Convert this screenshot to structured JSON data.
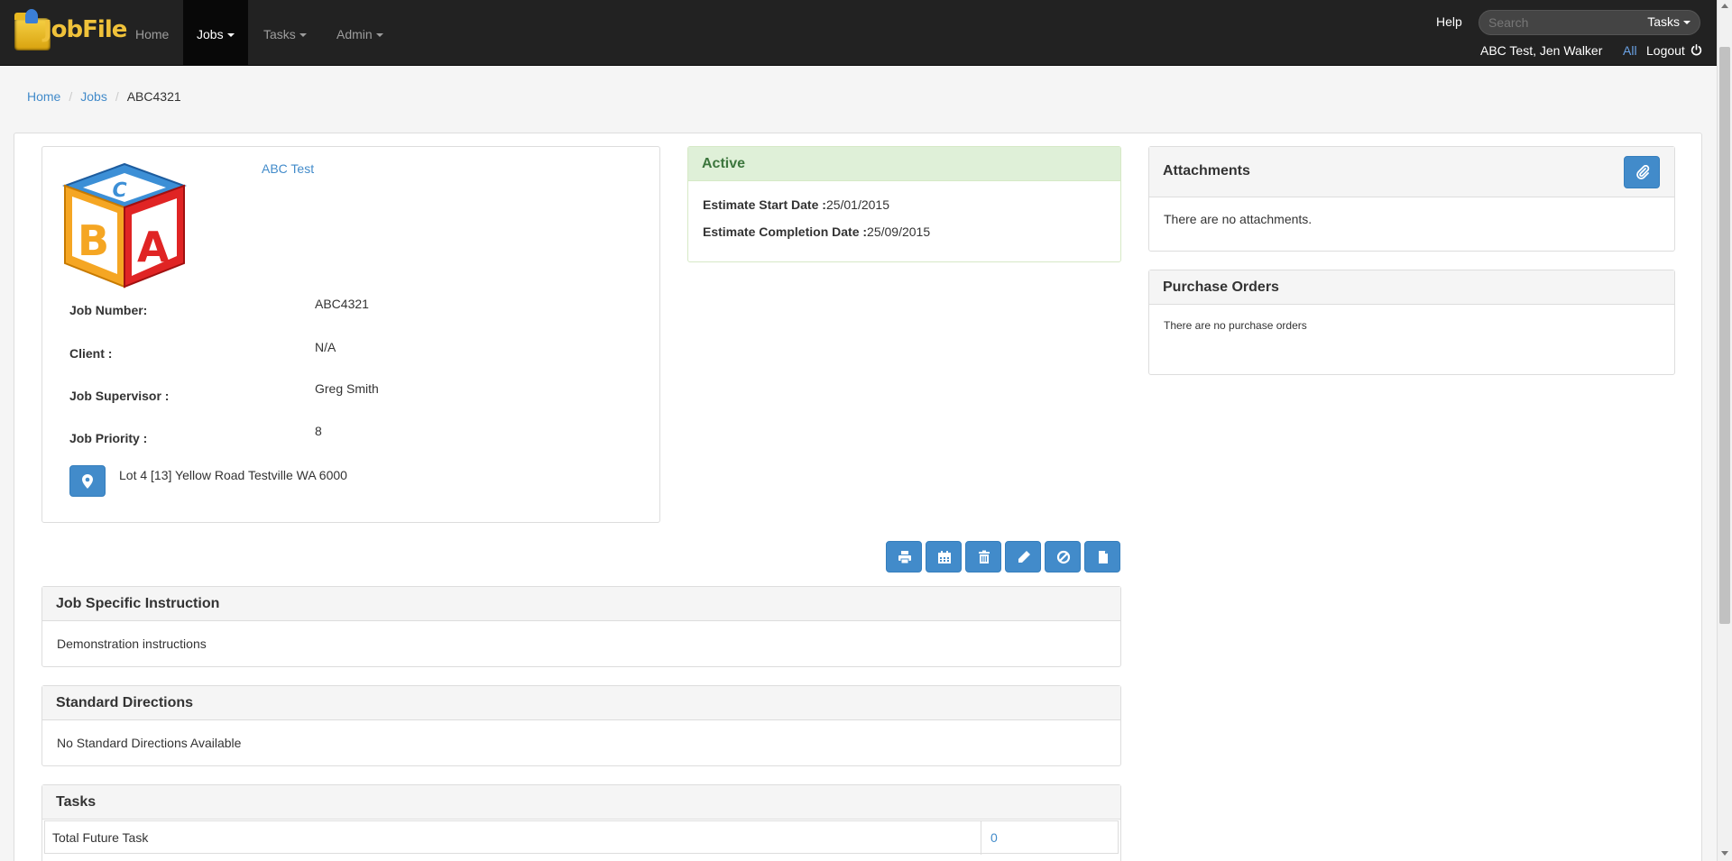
{
  "navbar": {
    "brand": "JobFile",
    "items": [
      {
        "label": "Home",
        "active": false,
        "dropdown": false
      },
      {
        "label": "Jobs",
        "active": true,
        "dropdown": true
      },
      {
        "label": "Tasks",
        "active": false,
        "dropdown": true
      },
      {
        "label": "Admin",
        "active": false,
        "dropdown": true
      }
    ],
    "help": "Help",
    "search": {
      "placeholder": "Search",
      "scope": "Tasks"
    },
    "user": "ABC Test, Jen Walker",
    "all": "All",
    "logout": "Logout"
  },
  "breadcrumb": [
    "Home",
    "Jobs",
    "ABC4321"
  ],
  "job": {
    "client_link": "ABC Test",
    "fields": [
      {
        "label": "Job Number:",
        "value": "ABC4321"
      },
      {
        "label": "Client :",
        "value": "N/A"
      },
      {
        "label": "Job Supervisor :",
        "value": "Greg Smith"
      },
      {
        "label": "Job Priority :",
        "value": "8"
      }
    ],
    "address": "Lot 4 [13] Yellow Road Testville WA 6000"
  },
  "status": {
    "title": "Active",
    "start_label": "Estimate Start Date :",
    "start_value": "25/01/2015",
    "completion_label": "Estimate Completion Date :",
    "completion_value": "25/09/2015"
  },
  "attachments": {
    "title": "Attachments",
    "empty": "There are no attachments."
  },
  "purchase_orders": {
    "title": "Purchase Orders",
    "empty": "There are no purchase orders"
  },
  "toolbar": [
    "print-icon",
    "calendar-icon",
    "trash-icon",
    "pencil-icon",
    "cancel-icon",
    "file-icon"
  ],
  "instructions": {
    "title": "Job Specific Instruction",
    "text": "Demonstration instructions"
  },
  "directions": {
    "title": "Standard Directions",
    "text": "No Standard Directions Available"
  },
  "tasks": {
    "title": "Tasks",
    "rows": [
      {
        "label": "Total Future Task",
        "value": "0"
      }
    ]
  },
  "colors": {
    "primary": "#428bca",
    "navbar": "#222222",
    "success_bg": "#dff0d8",
    "success_text": "#3c763d"
  }
}
